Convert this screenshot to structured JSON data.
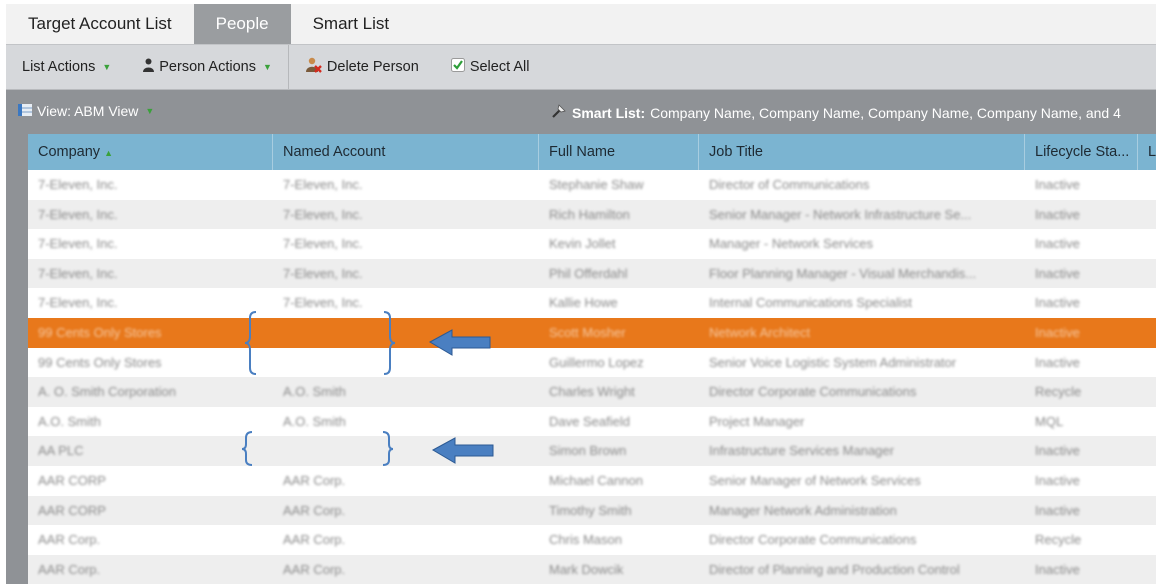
{
  "tabs": [
    {
      "label": "Target Account List",
      "active": false
    },
    {
      "label": "People",
      "active": true
    },
    {
      "label": "Smart List",
      "active": false
    }
  ],
  "toolbar": {
    "list_actions": "List Actions",
    "person_actions": "Person Actions",
    "delete_person": "Delete Person",
    "select_all": "Select All"
  },
  "viewbar": {
    "view_label": "View: ABM View",
    "smart_list_label": "Smart List:",
    "smart_list_value": "Company Name, Company Name, Company Name, Company Name, and 4"
  },
  "columns": [
    "Company",
    "Named Account",
    "Full Name",
    "Job Title",
    "Lifecycle Sta...",
    "La"
  ],
  "rows": [
    {
      "company": "7-Eleven, Inc.",
      "named_account": "7-Eleven, Inc.",
      "full_name": "Stephanie Shaw",
      "job_title": "Director of Communications",
      "lifecycle": "Inactive"
    },
    {
      "company": "7-Eleven, Inc.",
      "named_account": "7-Eleven, Inc.",
      "full_name": "Rich Hamilton",
      "job_title": "Senior Manager - Network Infrastructure Se...",
      "lifecycle": "Inactive"
    },
    {
      "company": "7-Eleven, Inc.",
      "named_account": "7-Eleven, Inc.",
      "full_name": "Kevin Jollet",
      "job_title": "Manager - Network Services",
      "lifecycle": "Inactive"
    },
    {
      "company": "7-Eleven, Inc.",
      "named_account": "7-Eleven, Inc.",
      "full_name": "Phil Offerdahl",
      "job_title": "Floor Planning Manager - Visual Merchandis...",
      "lifecycle": "Inactive"
    },
    {
      "company": "7-Eleven, Inc.",
      "named_account": "7-Eleven, Inc.",
      "full_name": "Kallie Howe",
      "job_title": "Internal Communications Specialist",
      "lifecycle": "Inactive"
    },
    {
      "company": "99 Cents Only Stores",
      "named_account": "",
      "full_name": "Scott Mosher",
      "job_title": "Network Architect",
      "lifecycle": "Inactive",
      "selected": true
    },
    {
      "company": "99 Cents Only Stores",
      "named_account": "",
      "full_name": "Guillermo Lopez",
      "job_title": "Senior Voice Logistic System Administrator",
      "lifecycle": "Inactive"
    },
    {
      "company": "A. O. Smith Corporation",
      "named_account": "A.O. Smith",
      "full_name": "Charles Wright",
      "job_title": "Director Corporate Communications",
      "lifecycle": "Recycle"
    },
    {
      "company": "A.O. Smith",
      "named_account": "A.O. Smith",
      "full_name": "Dave Seafield",
      "job_title": "Project Manager",
      "lifecycle": "MQL"
    },
    {
      "company": "AA PLC",
      "named_account": "",
      "full_name": "Simon Brown",
      "job_title": "Infrastructure Services Manager",
      "lifecycle": "Inactive"
    },
    {
      "company": "AAR CORP",
      "named_account": "AAR Corp.",
      "full_name": "Michael Cannon",
      "job_title": "Senior Manager of Network Services",
      "lifecycle": "Inactive"
    },
    {
      "company": "AAR CORP",
      "named_account": "AAR Corp.",
      "full_name": "Timothy Smith",
      "job_title": "Manager Network Administration",
      "lifecycle": "Inactive"
    },
    {
      "company": "AAR Corp.",
      "named_account": "AAR Corp.",
      "full_name": "Chris Mason",
      "job_title": "Director Corporate Communications",
      "lifecycle": "Recycle"
    },
    {
      "company": "AAR Corp.",
      "named_account": "AAR Corp.",
      "full_name": "Mark Dowcik",
      "job_title": "Director of Planning and Production Control",
      "lifecycle": "Inactive"
    }
  ],
  "colors": {
    "tab_active": "#9a9da0",
    "toolbar": "#d6d8db",
    "view_bar": "#8f9296",
    "header": "#7bb4d1",
    "selected_row": "#e8781b",
    "annotation": "#4a7fc1"
  }
}
